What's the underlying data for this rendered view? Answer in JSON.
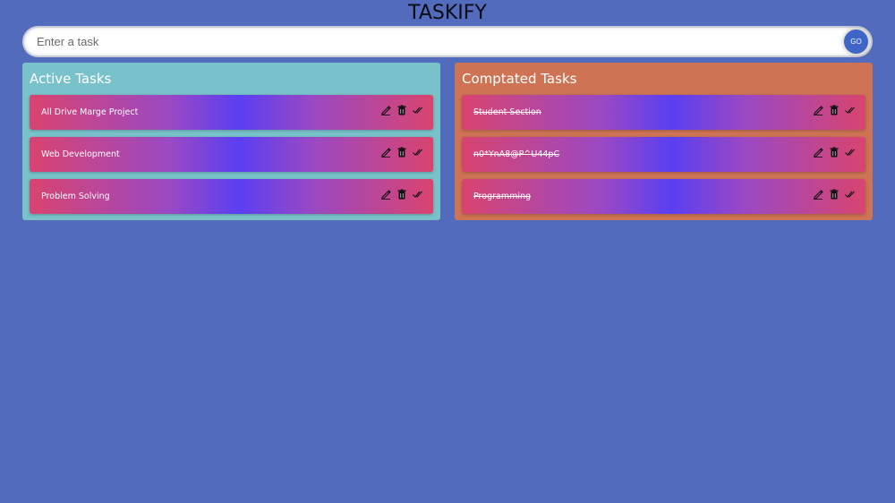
{
  "app": {
    "title": "TASKIFY"
  },
  "input": {
    "placeholder": "Enter a task",
    "value": "",
    "go_label": "GO"
  },
  "active_panel": {
    "title": "Active Tasks",
    "tasks": [
      {
        "text": "All Drive Marge Project"
      },
      {
        "text": "Web Development"
      },
      {
        "text": "Problem Solving"
      }
    ]
  },
  "completed_panel": {
    "title": "Comptated Tasks",
    "tasks": [
      {
        "text": "Student Section"
      },
      {
        "text": "n0*YnA8@P^U44pC"
      },
      {
        "text": "Programming"
      }
    ]
  },
  "icons": {
    "edit": "edit-icon",
    "delete": "trash-icon",
    "done": "double-check-icon"
  },
  "colors": {
    "background": "#536bbd",
    "active_panel": "#79c2ca",
    "completed_panel": "#ce7455",
    "go_button": "#3f66c6"
  }
}
